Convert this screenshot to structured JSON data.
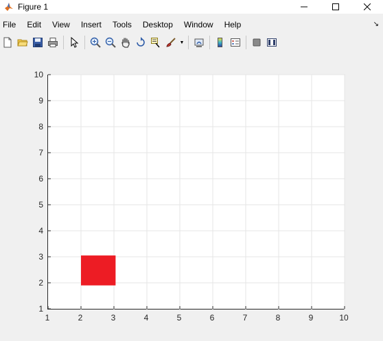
{
  "window": {
    "title": "Figure 1",
    "controls": [
      "minimize",
      "maximize",
      "close"
    ]
  },
  "menu": [
    "File",
    "Edit",
    "View",
    "Insert",
    "Tools",
    "Desktop",
    "Window",
    "Help"
  ],
  "toolbar": {
    "icons": [
      "new-figure-icon",
      "open-file-icon",
      "save-icon",
      "print-icon",
      "edit-plot-arrow-icon",
      "zoom-in-icon",
      "zoom-out-icon",
      "pan-hand-icon",
      "rotate-3d-icon",
      "data-cursor-icon",
      "brush-icon",
      "link-plot-icon",
      "colorbar-icon",
      "legend-icon",
      "hide-plot-tools-icon",
      "show-plot-tools-icon"
    ]
  },
  "colors": {
    "rectangle_fill": "#ed1c24",
    "grid": "#e6e6e6",
    "axis": "#262626"
  },
  "chart_data": {
    "type": "area",
    "title": "",
    "xlabel": "",
    "ylabel": "",
    "xlim": [
      1,
      10
    ],
    "ylim": [
      1,
      10
    ],
    "xticks": [
      "1",
      "2",
      "3",
      "4",
      "5",
      "6",
      "7",
      "8",
      "9",
      "10"
    ],
    "yticks": [
      "1",
      "2",
      "3",
      "4",
      "5",
      "6",
      "7",
      "8",
      "9",
      "10"
    ],
    "grid": true,
    "shapes": [
      {
        "shape": "rectangle",
        "x": 2,
        "y": 1.9,
        "width": 1.05,
        "height": 1.15,
        "color": "#ed1c24"
      }
    ]
  }
}
